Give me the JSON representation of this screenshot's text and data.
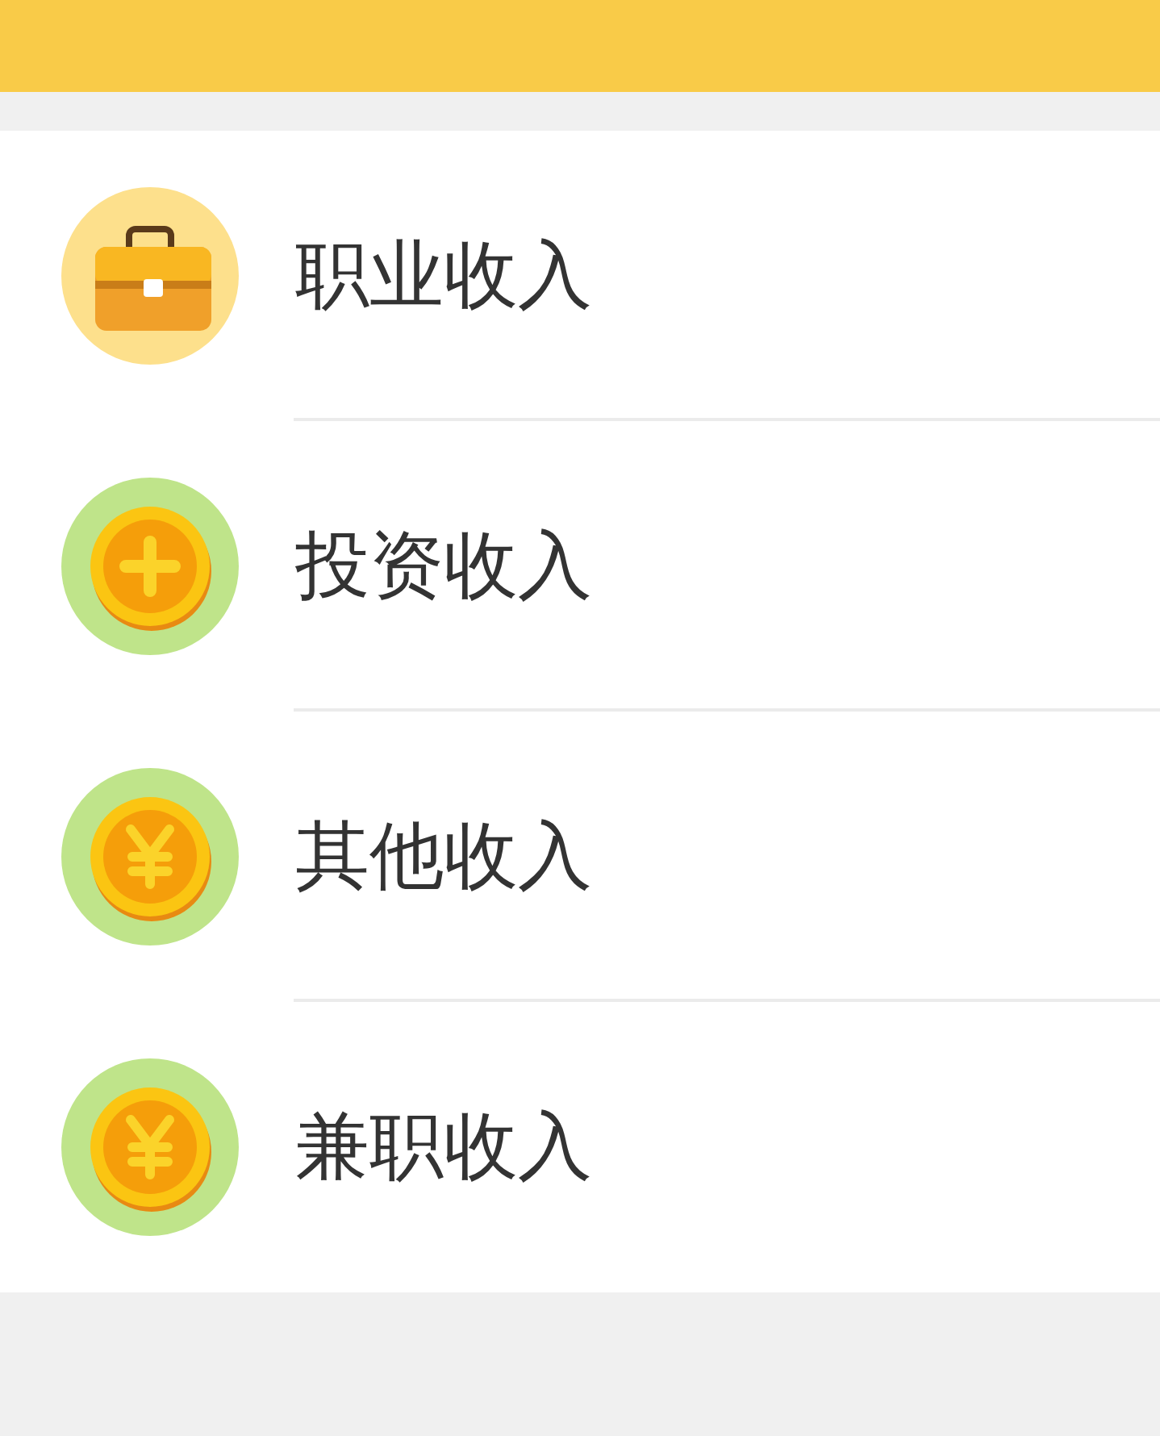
{
  "categories": [
    {
      "kind": "briefcase",
      "label": "职业收入"
    },
    {
      "kind": "plus-coin",
      "label": "投资收入"
    },
    {
      "kind": "yen-coin",
      "label": "其他收入"
    },
    {
      "kind": "yen-coin",
      "label": "兼职收入"
    }
  ]
}
